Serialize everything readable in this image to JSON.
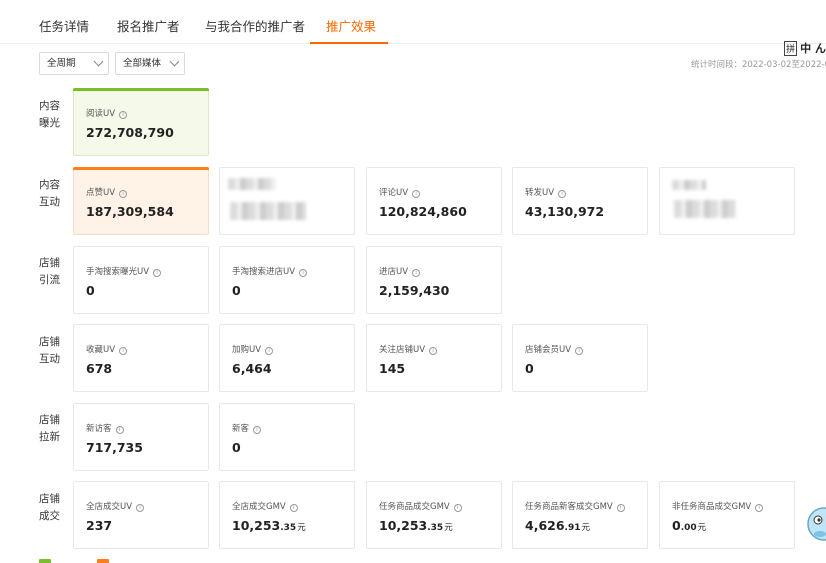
{
  "tabs": [
    {
      "label": "任务详情"
    },
    {
      "label": "报名推广者"
    },
    {
      "label": "与我合作的推广者"
    },
    {
      "label": "推广效果"
    }
  ],
  "filters": {
    "period": "全周期",
    "media": "全部媒体"
  },
  "stat_time": "统计时间段：2022-03-02至2022-0",
  "ime": {
    "box": "拼",
    "text": "中 ん"
  },
  "rows": [
    {
      "label": "内容曝光",
      "cards": [
        {
          "label": "阅读UV",
          "value": "272,708,790"
        }
      ]
    },
    {
      "label": "内容互动",
      "cards": [
        {
          "label": "点赞UV",
          "value": "187,309,584"
        },
        {
          "label": "评论UV",
          "value": "120,824,860"
        },
        {
          "label": "转发UV",
          "value": "43,130,972"
        }
      ]
    },
    {
      "label": "店铺引流",
      "cards": [
        {
          "label": "手淘搜索曝光UV",
          "value": "0"
        },
        {
          "label": "手淘搜索进店UV",
          "value": "0"
        },
        {
          "label": "进店UV",
          "value": "2,159,430"
        }
      ]
    },
    {
      "label": "店铺互动",
      "cards": [
        {
          "label": "收藏UV",
          "value": "678"
        },
        {
          "label": "加购UV",
          "value": "6,464"
        },
        {
          "label": "关注店铺UV",
          "value": "145"
        },
        {
          "label": "店铺会员UV",
          "value": "0"
        }
      ]
    },
    {
      "label": "店铺拉新",
      "cards": [
        {
          "label": "新访客",
          "value": "717,735"
        },
        {
          "label": "新客",
          "value": "0"
        }
      ]
    },
    {
      "label": "店铺成交",
      "cards": [
        {
          "label": "全店成交UV",
          "value": "237"
        },
        {
          "label": "全店成交GMV",
          "value": "10,253",
          "dec": ".35",
          "unit": "元"
        },
        {
          "label": "任务商品成交GMV",
          "value": "10,253",
          "dec": ".35",
          "unit": "元"
        },
        {
          "label": "任务商品新客成交GMV",
          "value": "4,626",
          "dec": ".91",
          "unit": "元"
        },
        {
          "label": "非任务商品成交GMV",
          "value": "0",
          "dec": ".00",
          "unit": "元"
        }
      ]
    }
  ],
  "colors": {
    "accent": "#ff6a00",
    "green": "#7cbd2b",
    "orange": "#ff7d1a"
  },
  "icons": {
    "info": "info-circle-icon",
    "dropdown": "chevron-down-icon"
  }
}
